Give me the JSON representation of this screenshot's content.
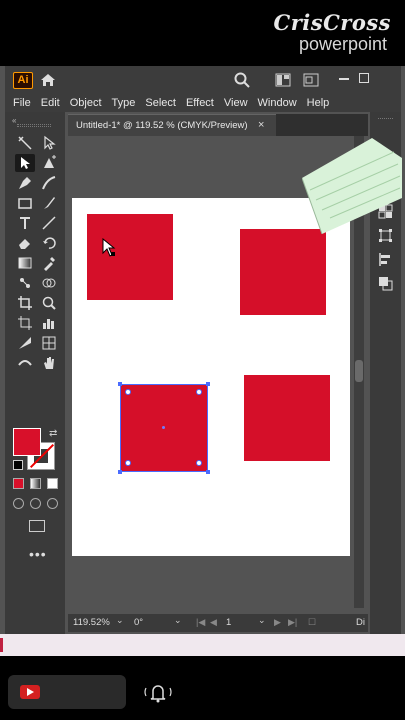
{
  "watermark": {
    "line1": "CrisCross",
    "line2": "powerpoint"
  },
  "app": {
    "logo_text": "Ai",
    "menu": [
      "File",
      "Edit",
      "Object",
      "Type",
      "Select",
      "Effect",
      "View",
      "Window",
      "Help"
    ],
    "document_tab": {
      "title": "Untitled-1* @ 119.52 % (CMYK/Preview)",
      "close_glyph": "×"
    },
    "fill_color": "#d8102a",
    "shape_color": "#d50f29",
    "selection_color": "#4a6cff",
    "more_tools": "•••"
  },
  "statusbar": {
    "zoom": "119.52%",
    "rotation": "0°",
    "page": "1",
    "right_text": "Di"
  },
  "icons": {
    "titlebar": [
      "home-icon",
      "search-icon",
      "arrange-documents-icon",
      "panel-layout-icon",
      "minimize-icon",
      "maximize-icon"
    ],
    "tools": [
      "selection-tool-icon",
      "direct-selection-tool-icon",
      "pen-tool-icon",
      "curvature-tool-icon",
      "rectangle-tool-icon",
      "brush-tool-icon",
      "type-tool-icon",
      "line-tool-icon",
      "eraser-tool-icon",
      "rotate-tool-icon",
      "gradient-tool-icon",
      "eyedropper-tool-icon",
      "puppet-warp-icon",
      "zoom-tool-icon",
      "crop-tool-icon",
      "artboard-tool-icon",
      "graph-tool-icon",
      "slice-tool-icon",
      "mesh-tool-icon",
      "hand-tool-icon"
    ],
    "right_panel": [
      "properties-icon",
      "layers-icon",
      "libraries-icon",
      "transform-icon",
      "align-icon",
      "pathfinder-icon"
    ]
  }
}
